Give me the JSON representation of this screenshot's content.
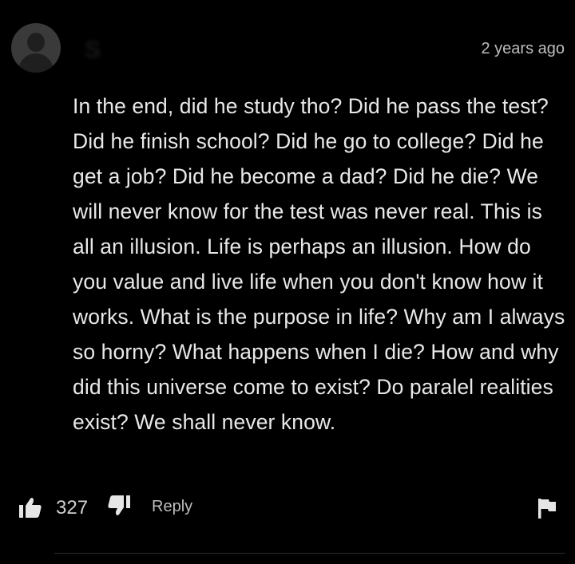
{
  "comment": {
    "username": "S",
    "timestamp": "2 years ago",
    "text": "In the end, did he study tho? Did he pass the test? Did he finish school? Did he go to college? Did he get a job? Did he become a dad? Did he die? We will never know for the test was never real. This is all an illusion. Life is perhaps an illusion. How do you value and live life when you don't know how it works. What is the purpose in life? Why am I always so horny? What happens when I die? How and why did this universe come to exist? Do paralel realities exist? We shall never know.",
    "actions": {
      "like_icon": "thumbs-up-icon",
      "like_count": "327",
      "dislike_icon": "thumbs-down-icon",
      "reply_label": "Reply",
      "flag_icon": "flag-icon"
    }
  },
  "colors": {
    "background": "#000000",
    "text": "#e8e8e8",
    "muted": "#bdbdbd"
  }
}
